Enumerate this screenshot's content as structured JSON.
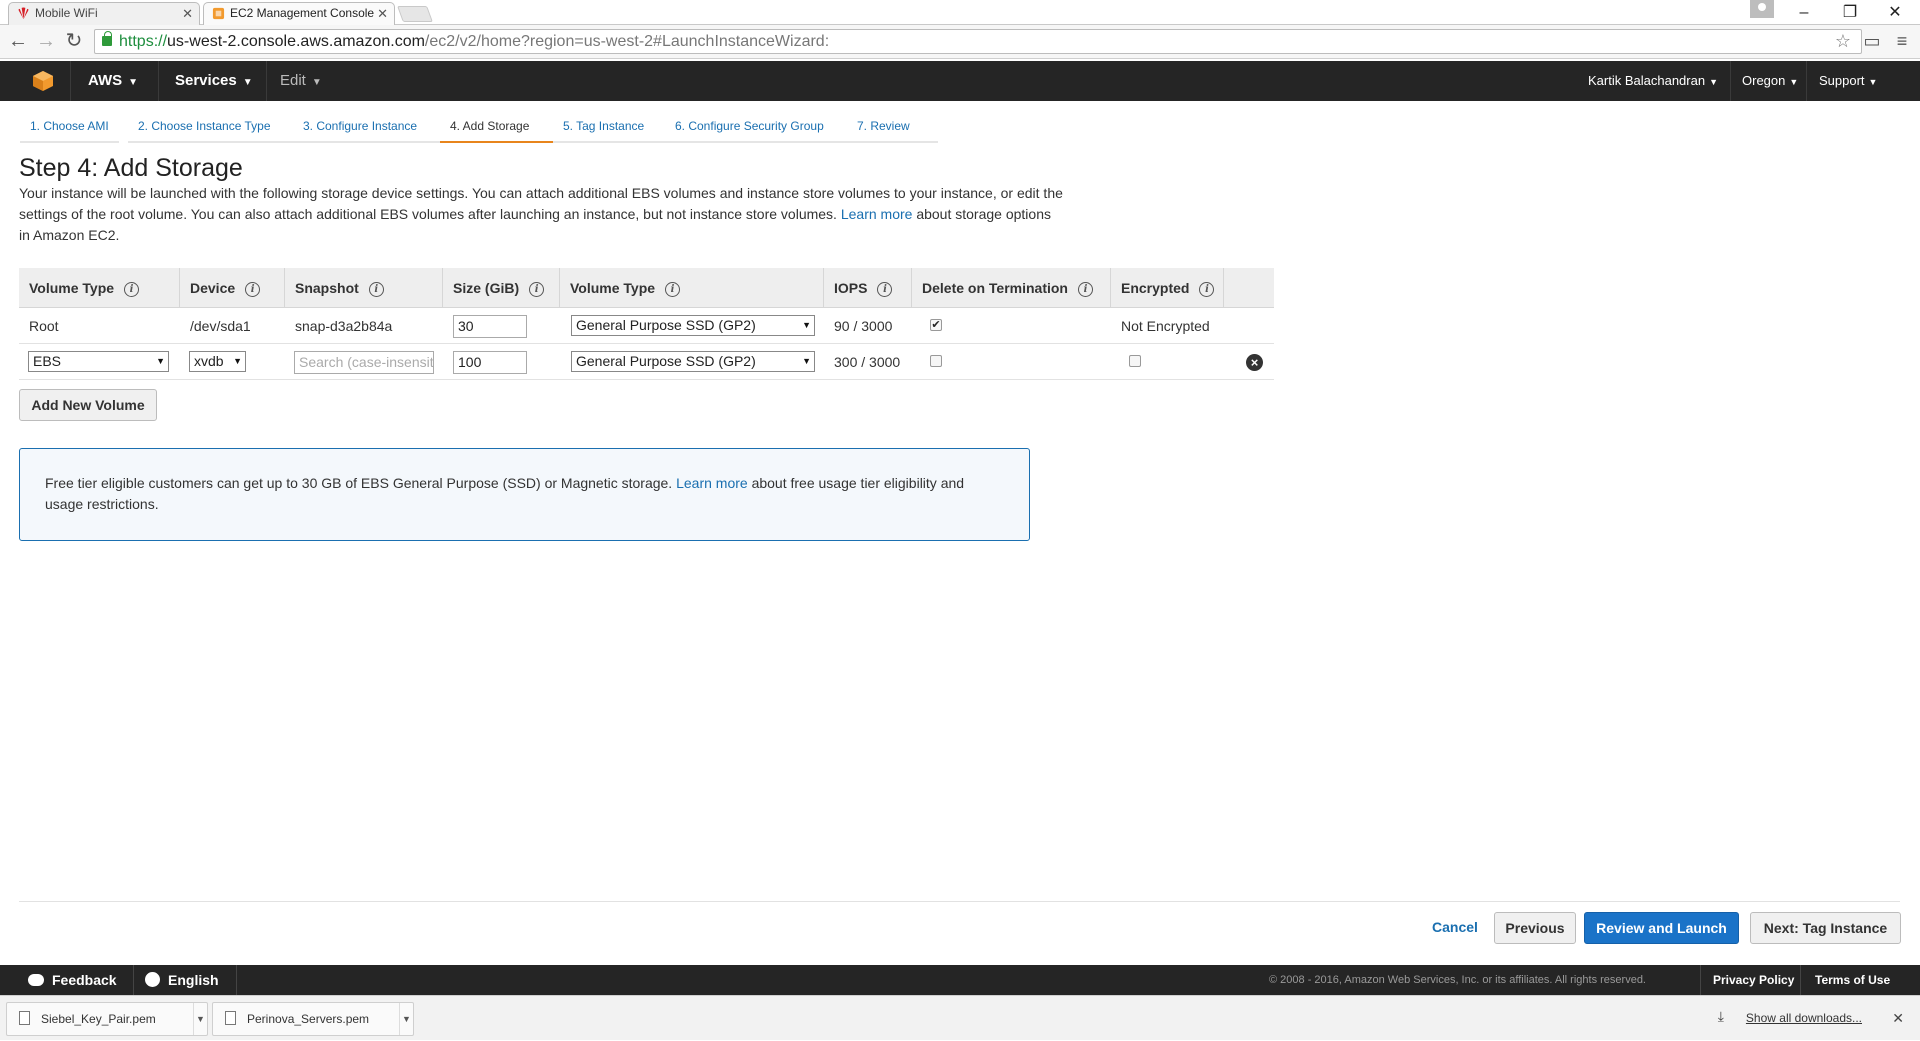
{
  "browser": {
    "tabs": [
      {
        "title": "Mobile WiFi"
      },
      {
        "title": "EC2 Management Console"
      }
    ],
    "url": {
      "scheme": "https://",
      "host": "us-west-2.console.aws.amazon.com",
      "path": "/ec2/v2/home?region=us-west-2#LaunchInstanceWizard:"
    }
  },
  "aws_header": {
    "brand": "AWS",
    "services": "Services",
    "edit": "Edit",
    "user": "Kartik Balachandran",
    "region": "Oregon",
    "support": "Support"
  },
  "wizard": {
    "steps": [
      {
        "label": "1. Choose AMI"
      },
      {
        "label": "2. Choose Instance Type"
      },
      {
        "label": "3. Configure Instance"
      },
      {
        "label": "4. Add Storage"
      },
      {
        "label": "5. Tag Instance"
      },
      {
        "label": "6. Configure Security Group"
      },
      {
        "label": "7. Review"
      }
    ],
    "active_step": "4. Add Storage"
  },
  "page": {
    "title": "Step 4: Add Storage",
    "intro_1": "Your instance will be launched with the following storage device settings. You can attach additional EBS volumes and instance store volumes to your instance, or edit the settings of the root volume. You can also attach additional EBS volumes after launching an instance, but not instance store volumes.",
    "intro_link": "Learn more",
    "intro_2": "about storage options in Amazon EC2."
  },
  "table": {
    "headers": [
      "Volume Type",
      "Device",
      "Snapshot",
      "Size (GiB)",
      "Volume Type",
      "IOPS",
      "Delete on Termination",
      "Encrypted"
    ],
    "rows": [
      {
        "volume_type": "Root",
        "device": "/dev/sda1",
        "snapshot": "snap-d3a2b84a",
        "size": "30",
        "ebs_type": "General Purpose SSD (GP2)",
        "iops": "90 / 3000",
        "delete_on_termination": true,
        "encrypted": "Not Encrypted"
      },
      {
        "volume_type": "EBS",
        "device": "xvdb",
        "snapshot_placeholder": "Search (case-insensit",
        "size": "100",
        "ebs_type": "General Purpose SSD (GP2)",
        "iops": "300 / 3000",
        "delete_on_termination": false,
        "encrypted": false
      }
    ]
  },
  "buttons": {
    "add_volume": "Add New Volume",
    "cancel": "Cancel",
    "previous": "Previous",
    "review_launch": "Review and Launch",
    "next": "Next: Tag Instance"
  },
  "infobox": {
    "text_1": "Free tier eligible customers can get up to 30 GB of EBS General Purpose (SSD) or Magnetic storage.",
    "link": "Learn more",
    "text_2": "about free usage tier eligibility and usage restrictions."
  },
  "footer": {
    "feedback": "Feedback",
    "language": "English",
    "copyright": "© 2008 - 2016, Amazon Web Services, Inc. or its affiliates. All rights reserved.",
    "privacy": "Privacy Policy",
    "terms": "Terms of Use"
  },
  "downloads": {
    "items": [
      {
        "name": "Siebel_Key_Pair.pem"
      },
      {
        "name": "Perinova_Servers.pem"
      }
    ],
    "show_all": "Show all downloads..."
  },
  "colors": {
    "aws_bar": "#252525",
    "link": "#1a6fb0",
    "primary": "#1a73c8",
    "active_step": "#e8851c"
  }
}
